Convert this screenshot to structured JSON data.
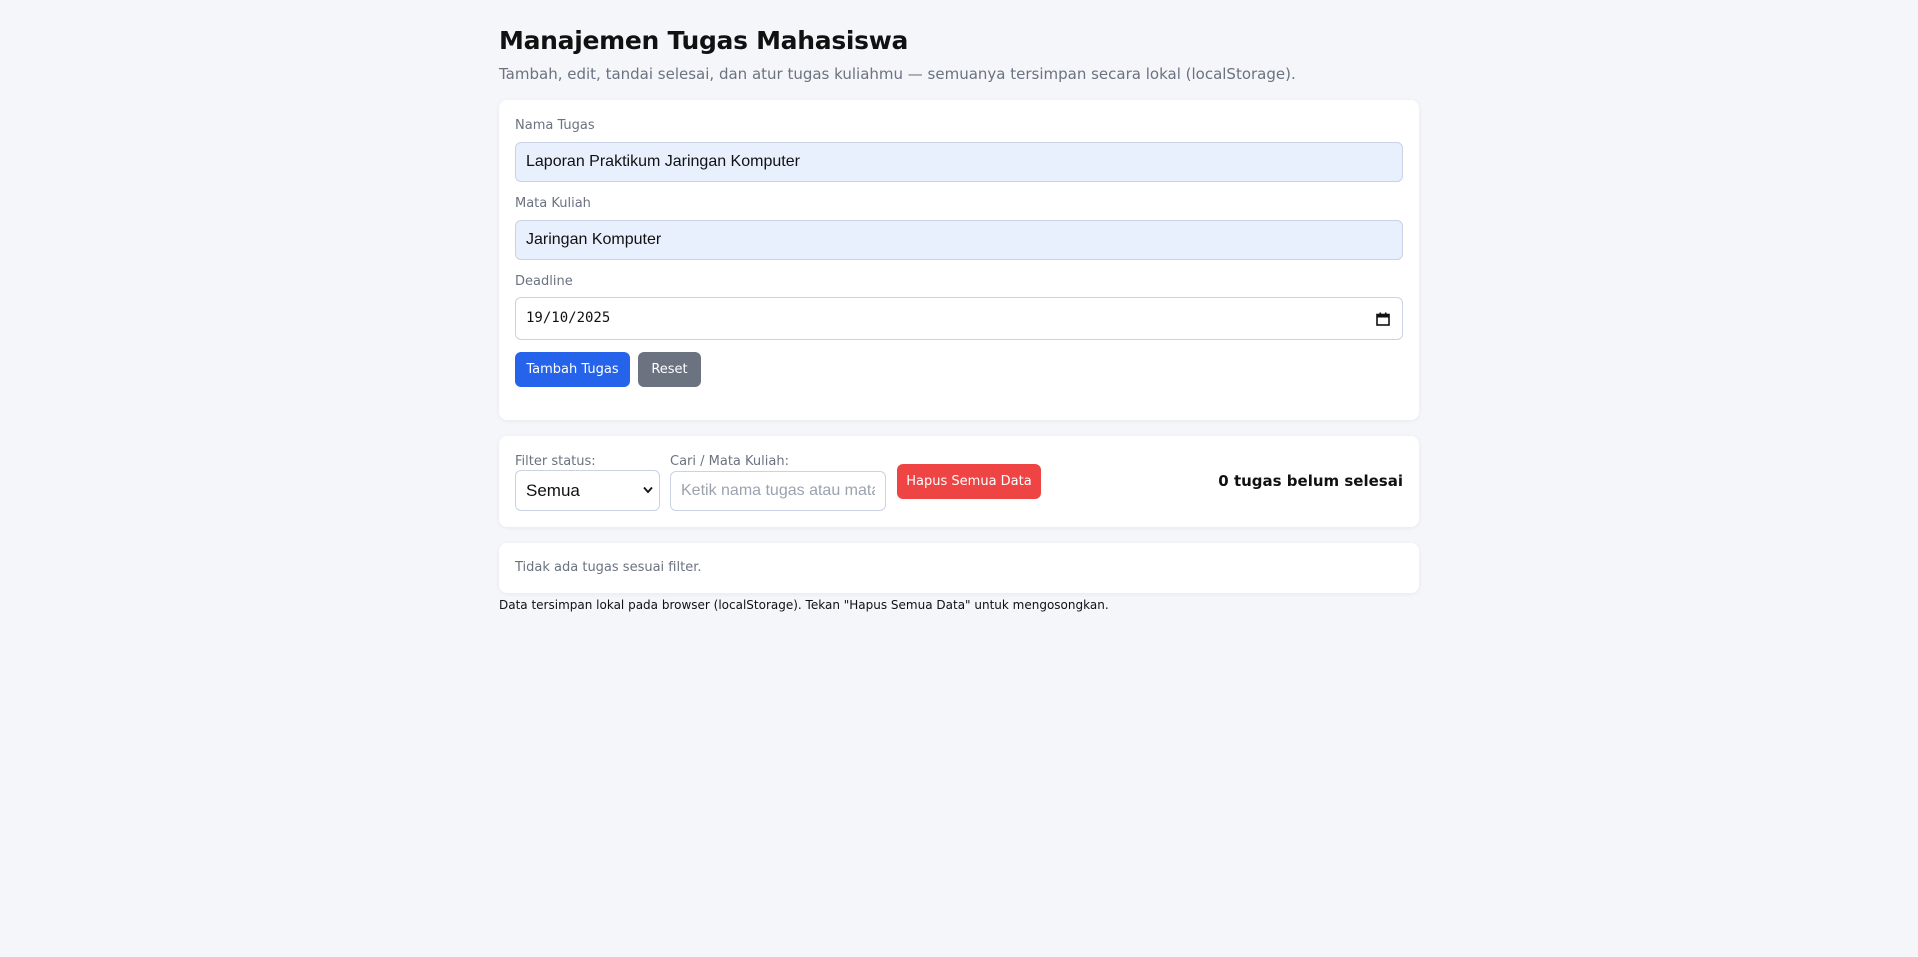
{
  "header": {
    "title": "Manajemen Tugas Mahasiswa",
    "subtitle": "Tambah, edit, tandai selesai, dan atur tugas kuliahmu — semuanya tersimpan secara lokal (localStorage)."
  },
  "form": {
    "task_name_label": "Nama Tugas",
    "task_name_value": "Laporan Praktikum Jaringan Komputer",
    "course_label": "Mata Kuliah",
    "course_value": "Jaringan Komputer",
    "deadline_label": "Deadline",
    "deadline_value": "19/10/2025",
    "add_button": "Tambah Tugas",
    "reset_button": "Reset"
  },
  "controls": {
    "filter_label": "Filter status:",
    "filter_value": "Semua",
    "search_label": "Cari / Mata Kuliah:",
    "search_placeholder": "Ketik nama tugas atau mata kuliah",
    "clear_button": "Hapus Semua Data",
    "counter": "0 tugas belum selesai"
  },
  "list": {
    "empty_message": "Tidak ada tugas sesuai filter."
  },
  "footer": {
    "note": "Data tersimpan lokal pada browser (localStorage). Tekan \"Hapus Semua Data\" untuk mengosongkan."
  },
  "colors": {
    "background": "#f4f6fa",
    "primary": "#2563eb",
    "secondary": "#6b7280",
    "danger": "#ef4444",
    "autofill": "#e8f0fe"
  }
}
